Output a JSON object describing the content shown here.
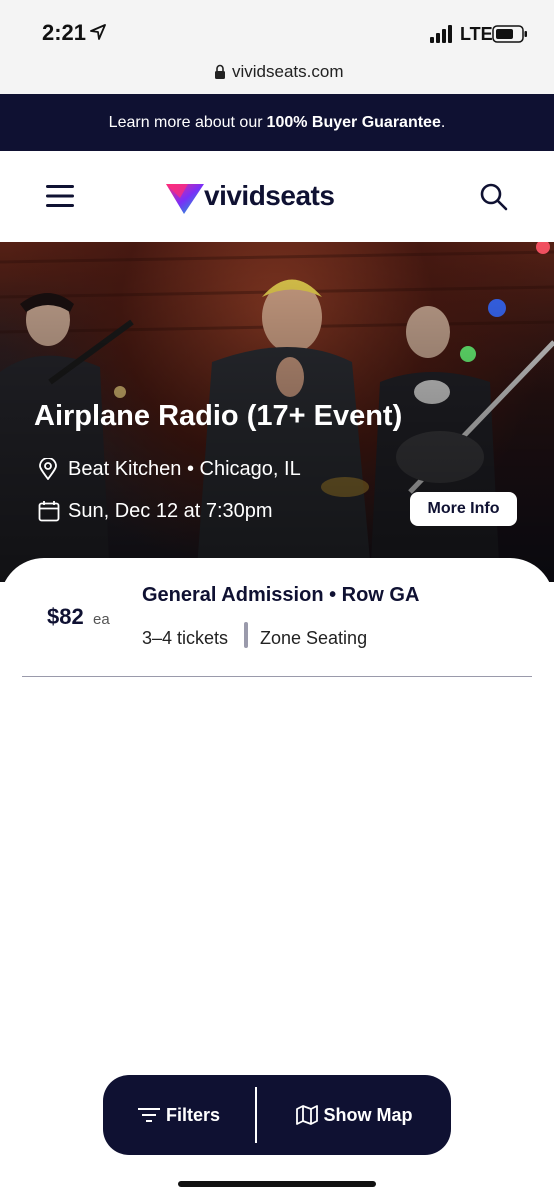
{
  "status_bar": {
    "time": "2:21",
    "network": "LTE"
  },
  "browser": {
    "url": "vividseats.com"
  },
  "banner": {
    "prefix": "Learn more about our",
    "emphasis": "100% Buyer Guarantee",
    "suffix": "."
  },
  "header": {
    "logo_text": "vividseats",
    "brand_colors": [
      "#ff2d7a",
      "#7b2ff7",
      "#00c2c7"
    ]
  },
  "event": {
    "title": "Airplane Radio (17+ Event)",
    "venue": "Beat Kitchen • Chicago, IL",
    "date": "Sun, Dec 12 at 7:30pm",
    "more_info_label": "More Info"
  },
  "listing": {
    "price": "$82",
    "price_unit": "ea",
    "section": "General Admission • Row GA",
    "quantity": "3–4 tickets",
    "seating": "Zone Seating"
  },
  "bottom_bar": {
    "filters_label": "Filters",
    "map_label": "Show Map"
  },
  "colors": {
    "navy": "#0f1132",
    "divider": "#9a9aab"
  }
}
